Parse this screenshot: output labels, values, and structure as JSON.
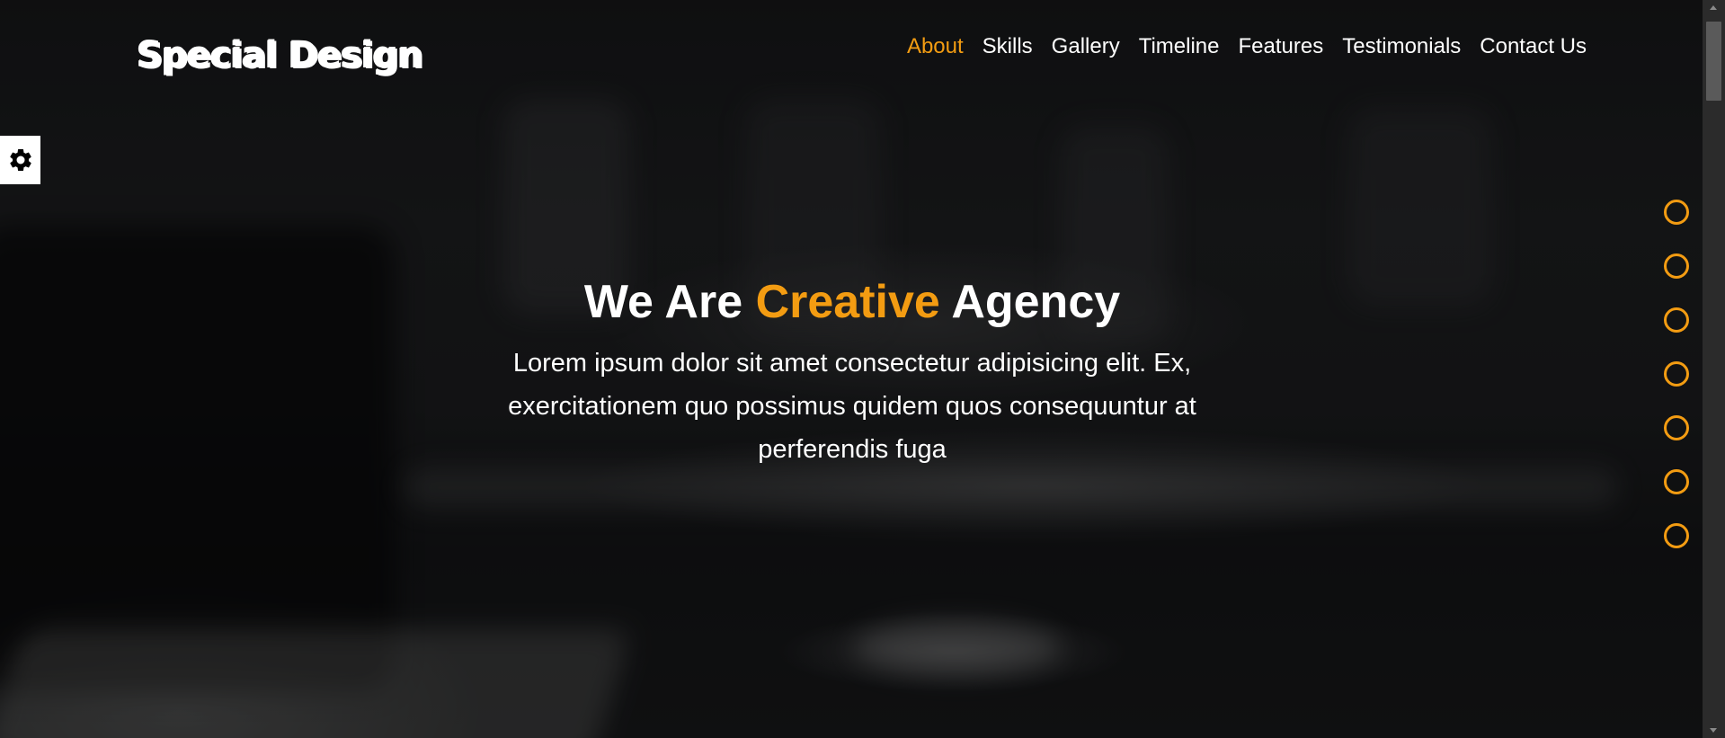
{
  "brand": {
    "logo_text": "Special Design"
  },
  "nav": {
    "items": [
      {
        "label": "About",
        "active": true
      },
      {
        "label": "Skills",
        "active": false
      },
      {
        "label": "Gallery",
        "active": false
      },
      {
        "label": "Timeline",
        "active": false
      },
      {
        "label": "Features",
        "active": false
      },
      {
        "label": "Testimonials",
        "active": false
      },
      {
        "label": "Contact Us",
        "active": false
      }
    ]
  },
  "hero": {
    "title_part1": "We Are ",
    "title_accent": "Creative",
    "title_part2": " Agency",
    "description": "Lorem ipsum dolor sit amet consectetur adipisicing elit. Ex, exercitationem quo possimus quidem quos consequuntur at perferendis fuga"
  },
  "settings": {
    "icon": "gear-icon"
  },
  "nav_bullets": {
    "count": 7
  },
  "colors": {
    "accent": "#f39c12",
    "text": "#ffffff",
    "background": "#1b1c1e"
  }
}
